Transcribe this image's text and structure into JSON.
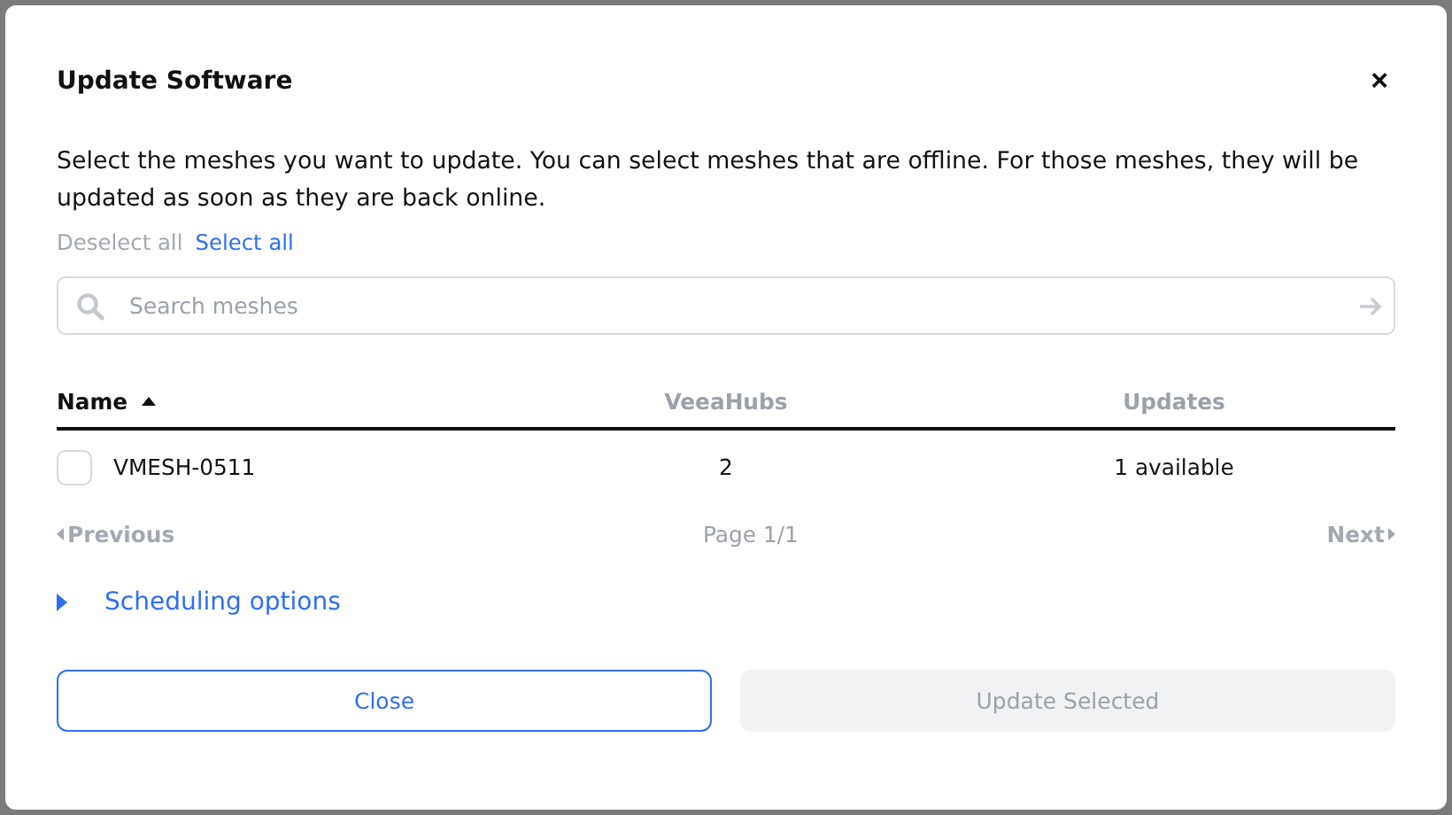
{
  "dialog": {
    "title": "Update Software",
    "close_label": "×"
  },
  "description": "Select the meshes you want to update. You can select meshes that are offline. For those meshes, they will be updated as soon as they are back online.",
  "selection_links": [
    {
      "label": "Deselect all",
      "disabled": true
    },
    {
      "label": "Select all",
      "disabled": false
    }
  ],
  "search": {
    "placeholder": "Search meshes"
  },
  "table": {
    "columns": [
      {
        "label": "Name",
        "sorted": true,
        "active": true
      },
      {
        "label": "VeeaHubs",
        "sorted": false,
        "active": false
      },
      {
        "label": "Updates",
        "sorted": false,
        "active": false
      }
    ],
    "rows": [
      {
        "checked": false,
        "cells": [
          "VMESH-0511",
          "2",
          "1 available"
        ]
      }
    ]
  },
  "pagination": {
    "previous": {
      "label": "Previous",
      "disabled": true
    },
    "page": "Page 1/1",
    "next": {
      "label": "Next",
      "disabled": true
    }
  },
  "scheduling": {
    "label": "Scheduling options",
    "expanded": false
  },
  "buttons": [
    {
      "label": "Close",
      "kind": "outline",
      "disabled": false
    },
    {
      "label": "Update Selected",
      "kind": "primary",
      "disabled": true
    }
  ]
}
